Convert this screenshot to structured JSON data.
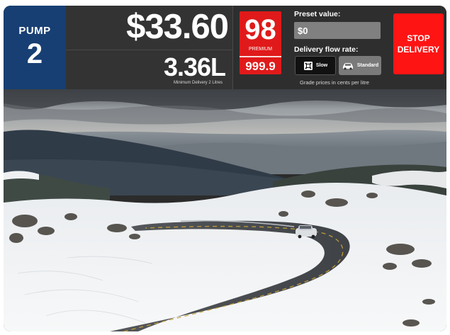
{
  "pump": {
    "label": "PUMP",
    "number": "2"
  },
  "delivery": {
    "amount": "$33.60",
    "volume": "3.36L",
    "minimum_note": "Minimum Delivery 2 Litres"
  },
  "grade": {
    "number": "98",
    "name": "PREMIUM",
    "price": "999.9",
    "color": "#e01a1a"
  },
  "preset": {
    "label": "Preset value:",
    "value": "$0"
  },
  "flow_rate": {
    "label": "Delivery flow rate:",
    "options": [
      {
        "label": "Slow",
        "icon": "fuel-drop-icon",
        "selected": true
      },
      {
        "label": "Standard",
        "icon": "car-icon",
        "selected": false
      }
    ]
  },
  "grade_note": "Grade prices in cents per litre",
  "stop_button": {
    "line1": "STOP",
    "line2": "DELIVERY",
    "color": "#ff1414"
  },
  "photo": {
    "subject": "snow-covered-mountain-road",
    "icon": "landscape-photo"
  },
  "colors": {
    "pump_blue": "#173f73",
    "panel_dark": "#2e2e2e"
  }
}
